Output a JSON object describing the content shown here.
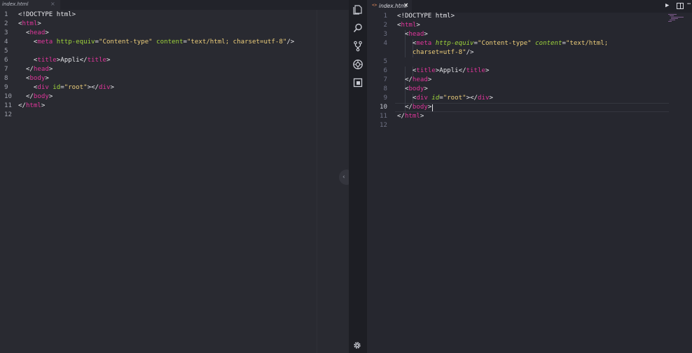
{
  "left": {
    "tab": {
      "label": "index.html",
      "close": "×"
    },
    "collapse_glyph": "‹",
    "lines": [
      {
        "n": "1",
        "segs": [
          {
            "t": "<!DOCTYPE html>",
            "c": "p"
          }
        ]
      },
      {
        "n": "2",
        "segs": [
          {
            "t": "<",
            "c": "p"
          },
          {
            "t": "html",
            "c": "t"
          },
          {
            "t": ">",
            "c": "p"
          }
        ]
      },
      {
        "n": "3",
        "segs": [
          {
            "t": "  <",
            "c": "p"
          },
          {
            "t": "head",
            "c": "t"
          },
          {
            "t": ">",
            "c": "p"
          }
        ]
      },
      {
        "n": "4",
        "segs": [
          {
            "t": "    <",
            "c": "p"
          },
          {
            "t": "meta",
            "c": "t"
          },
          {
            "t": " ",
            "c": "p"
          },
          {
            "t": "http-equiv",
            "c": "a"
          },
          {
            "t": "=",
            "c": "p"
          },
          {
            "t": "\"Content-type\"",
            "c": "s"
          },
          {
            "t": " ",
            "c": "p"
          },
          {
            "t": "content",
            "c": "a"
          },
          {
            "t": "=",
            "c": "p"
          },
          {
            "t": "\"text/html; charset=utf-8\"",
            "c": "s"
          },
          {
            "t": "/>",
            "c": "p"
          }
        ]
      },
      {
        "n": "5",
        "segs": []
      },
      {
        "n": "6",
        "segs": [
          {
            "t": "    <",
            "c": "p"
          },
          {
            "t": "title",
            "c": "t"
          },
          {
            "t": ">Appli</",
            "c": "p"
          },
          {
            "t": "title",
            "c": "t"
          },
          {
            "t": ">",
            "c": "p"
          }
        ]
      },
      {
        "n": "7",
        "segs": [
          {
            "t": "  </",
            "c": "p"
          },
          {
            "t": "head",
            "c": "t"
          },
          {
            "t": ">",
            "c": "p"
          }
        ]
      },
      {
        "n": "8",
        "segs": [
          {
            "t": "  <",
            "c": "p"
          },
          {
            "t": "body",
            "c": "t"
          },
          {
            "t": ">",
            "c": "p"
          }
        ]
      },
      {
        "n": "9",
        "segs": [
          {
            "t": "    <",
            "c": "p"
          },
          {
            "t": "div",
            "c": "t"
          },
          {
            "t": " ",
            "c": "p"
          },
          {
            "t": "id",
            "c": "a"
          },
          {
            "t": "=",
            "c": "p"
          },
          {
            "t": "\"root\"",
            "c": "s"
          },
          {
            "t": "></",
            "c": "p"
          },
          {
            "t": "div",
            "c": "t"
          },
          {
            "t": ">",
            "c": "p"
          }
        ]
      },
      {
        "n": "10",
        "segs": [
          {
            "t": "  </",
            "c": "p"
          },
          {
            "t": "body",
            "c": "t"
          },
          {
            "t": ">",
            "c": "p"
          }
        ]
      },
      {
        "n": "11",
        "segs": [
          {
            "t": "</",
            "c": "p"
          },
          {
            "t": "html",
            "c": "t"
          },
          {
            "t": ">",
            "c": "p"
          }
        ]
      },
      {
        "n": "12",
        "segs": []
      }
    ]
  },
  "activity": {
    "icons": [
      "files-icon",
      "search-icon",
      "source-control-icon",
      "debug-icon",
      "extensions-icon"
    ],
    "settings": "gear-icon"
  },
  "right": {
    "tab": {
      "label": "index.html",
      "close": "×",
      "icon": "<>"
    },
    "actions": {
      "run": "▶",
      "more": "⋯"
    },
    "current_line": "10",
    "lines": [
      {
        "n": "1",
        "segs": [
          {
            "t": "<!DOCTYPE html>",
            "c": "p"
          }
        ]
      },
      {
        "n": "2",
        "segs": [
          {
            "t": "<",
            "c": "p"
          },
          {
            "t": "html",
            "c": "t"
          },
          {
            "t": ">",
            "c": "p"
          }
        ]
      },
      {
        "n": "3",
        "segs": [
          {
            "t": "  <",
            "c": "p"
          },
          {
            "t": "head",
            "c": "t"
          },
          {
            "t": ">",
            "c": "p"
          }
        ]
      },
      {
        "n": "4",
        "segs": [
          {
            "t": "    <",
            "c": "p"
          },
          {
            "t": "meta",
            "c": "t"
          },
          {
            "t": " ",
            "c": "p"
          },
          {
            "t": "http-equiv",
            "c": "ai"
          },
          {
            "t": "=",
            "c": "p"
          },
          {
            "t": "\"Content-type\"",
            "c": "s"
          },
          {
            "t": " ",
            "c": "p"
          },
          {
            "t": "content",
            "c": "ai"
          },
          {
            "t": "=",
            "c": "p"
          },
          {
            "t": "\"text/html;",
            "c": "s"
          }
        ]
      },
      {
        "n": "",
        "segs": [
          {
            "t": "    charset=utf-8\"",
            "c": "s"
          },
          {
            "t": "/>",
            "c": "p"
          }
        ]
      },
      {
        "n": "5",
        "segs": []
      },
      {
        "n": "6",
        "segs": [
          {
            "t": "    <",
            "c": "p"
          },
          {
            "t": "title",
            "c": "t"
          },
          {
            "t": ">Appli</",
            "c": "p"
          },
          {
            "t": "title",
            "c": "t"
          },
          {
            "t": ">",
            "c": "p"
          }
        ]
      },
      {
        "n": "7",
        "segs": [
          {
            "t": "  </",
            "c": "p"
          },
          {
            "t": "head",
            "c": "t"
          },
          {
            "t": ">",
            "c": "p"
          }
        ]
      },
      {
        "n": "8",
        "segs": [
          {
            "t": "  <",
            "c": "p"
          },
          {
            "t": "body",
            "c": "t"
          },
          {
            "t": ">",
            "c": "p"
          }
        ]
      },
      {
        "n": "9",
        "segs": [
          {
            "t": "    <",
            "c": "p"
          },
          {
            "t": "div",
            "c": "t"
          },
          {
            "t": " ",
            "c": "p"
          },
          {
            "t": "id",
            "c": "ai"
          },
          {
            "t": "=",
            "c": "p"
          },
          {
            "t": "\"root\"",
            "c": "s"
          },
          {
            "t": "></",
            "c": "p"
          },
          {
            "t": "div",
            "c": "t"
          },
          {
            "t": ">",
            "c": "p"
          }
        ]
      },
      {
        "n": "10",
        "segs": [
          {
            "t": "  </",
            "c": "p"
          },
          {
            "t": "body",
            "c": "t"
          },
          {
            "t": ">",
            "c": "p"
          }
        ]
      },
      {
        "n": "11",
        "segs": [
          {
            "t": "</",
            "c": "p"
          },
          {
            "t": "html",
            "c": "t"
          },
          {
            "t": ">",
            "c": "p"
          }
        ]
      },
      {
        "n": "12",
        "segs": []
      }
    ]
  },
  "colors": {
    "tag": "#e0369b",
    "attribute": "#9fd53b",
    "string": "#eccd7a",
    "plain": "#e6e6ea",
    "background": "#26272f"
  }
}
